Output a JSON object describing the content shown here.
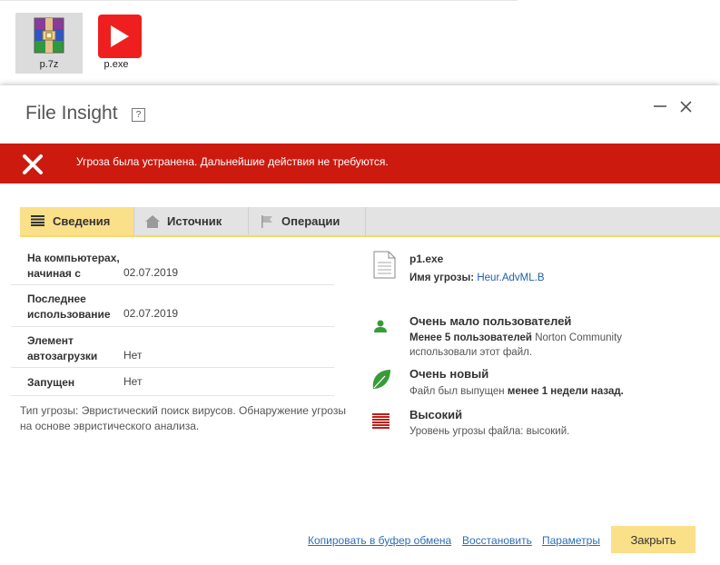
{
  "desktop": {
    "icons": [
      {
        "label": "p.7z",
        "selected": true
      },
      {
        "label": "p.exe",
        "selected": false
      }
    ]
  },
  "dialog": {
    "title": "File Insight",
    "help_glyph": "?",
    "alert": {
      "message": "Угроза была устранена. Дальнейшие действия не требуются.",
      "color": "#cc1a0f"
    },
    "tabs": [
      {
        "label": "Сведения",
        "active": true
      },
      {
        "label": "Источник",
        "active": false
      },
      {
        "label": "Операции",
        "active": false
      }
    ],
    "details": [
      {
        "key_line1": "На компьютерах,",
        "key_line2": "начиная с",
        "value": "02.07.2019"
      },
      {
        "key_line1": "Последнее",
        "key_line2": "использование",
        "value": "02.07.2019"
      },
      {
        "key_line1": "Элемент",
        "key_line2": "автозагрузки",
        "value": "Нет"
      },
      {
        "key_line1": "Запущен",
        "key_line2": "",
        "value": "Нет"
      }
    ],
    "threat_note": "Тип угрозы: Эвристический поиск вирусов. Обнаружение угрозы на основе эвристического анализа.",
    "file": {
      "name": "p1.exe",
      "threat_label": "Имя угрозы:",
      "threat_name": "Heur.AdvML.B"
    },
    "community": {
      "title": "Очень мало пользователей",
      "bold": "Менее 5 пользователей",
      "rest_line1": "Norton Community",
      "rest_line2": "использовали этот файл."
    },
    "age": {
      "title": "Очень новый",
      "text": "Файл был выпущен",
      "bold": "менее 1 недели назад."
    },
    "risk": {
      "title": "Высокий",
      "text": "Уровень угрозы файла: высокий."
    },
    "footer": {
      "copy_link": "Копировать в буфер обмена",
      "restore_link": "Восстановить",
      "params_link": "Параметры",
      "close_label": "Закрыть"
    },
    "colors": {
      "accent_yellow": "#fbe08a",
      "green": "#3a9a3a",
      "risk_red": "#c0201a",
      "link_blue": "#2d6fb6"
    }
  }
}
